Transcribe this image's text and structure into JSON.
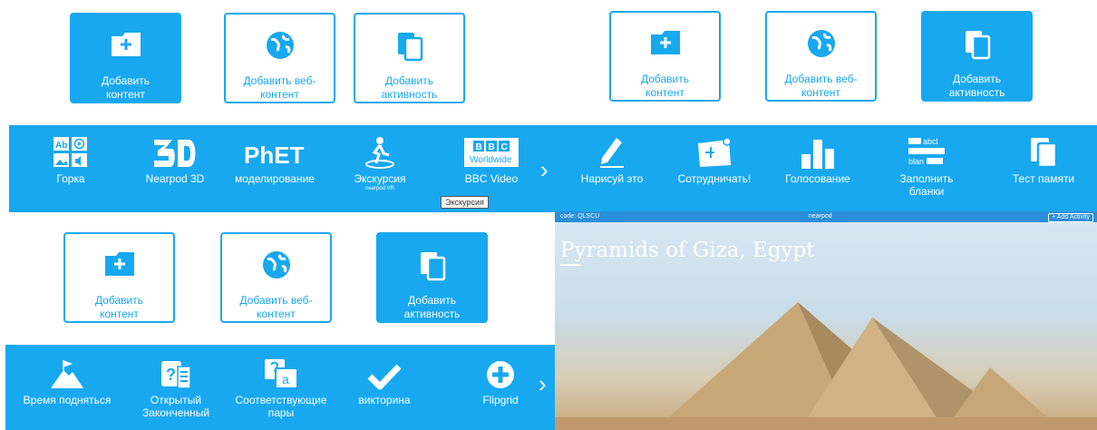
{
  "cards": {
    "add_content": "Добавить\nконтент",
    "add_web": "Добавить веб-\nконтент",
    "add_activity": "Добавить\nактивность"
  },
  "panel1_tools": [
    {
      "label": "Горка",
      "icon": "slides-icon"
    },
    {
      "label": "Nearpod 3D",
      "icon": "3d-icon"
    },
    {
      "label": "моделирование",
      "icon": "phet-icon"
    },
    {
      "label": "Экскурсия",
      "sub": "nearpod VR",
      "icon": "field-trip-icon"
    },
    {
      "label": "BBC Video",
      "icon": "bbc-icon"
    }
  ],
  "logos": {
    "phet": "PhET",
    "bbc_letters": [
      "B",
      "B",
      "C"
    ],
    "bbc_word": "Worldwide",
    "ab": "Ab"
  },
  "tooltip": "Экскурсия",
  "panel2_tools": [
    {
      "label": "Нарисуй это",
      "icon": "pencil-icon"
    },
    {
      "label": "Сотрудничать!",
      "icon": "board-icon"
    },
    {
      "label": "Голосование",
      "icon": "poll-icon"
    },
    {
      "label": "Заполнить\nбланки",
      "icon": "fill-blanks-icon"
    },
    {
      "label": "Тест памяти",
      "icon": "memory-icon"
    }
  ],
  "blank_words": [
    "abcl",
    "blan"
  ],
  "panel3_tools": [
    {
      "label": "Время подняться",
      "icon": "flag-mountain-icon"
    },
    {
      "label": "Открытый\nЗаконченный",
      "icon": "open-ended-icon"
    },
    {
      "label": "Соответствующие\nпары",
      "icon": "matching-pairs-icon"
    },
    {
      "label": "викторина",
      "icon": "checkmark-icon"
    },
    {
      "label": "Flipgrid",
      "icon": "plus-circle-icon"
    }
  ],
  "matching_letter": "a",
  "nearpod": {
    "code": "code: QLSCU",
    "brand": "nearpod",
    "add_button": "+ Add Activity",
    "title": "Pyramids of Giza, Egypt"
  },
  "colors": {
    "accent": "#18a8f0"
  }
}
